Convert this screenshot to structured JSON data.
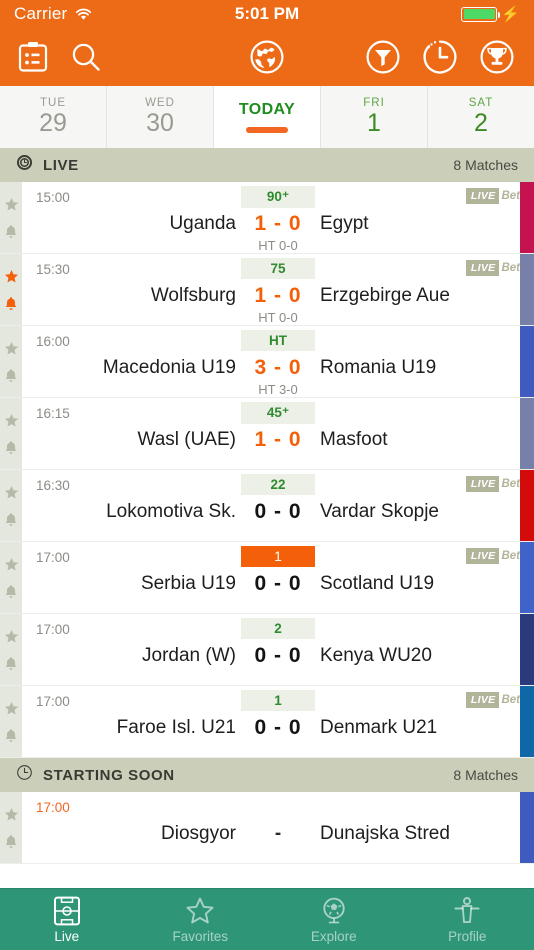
{
  "status_bar": {
    "carrier": "Carrier",
    "wifi_icon": "wifi-icon",
    "time": "5:01 PM",
    "battery_icon": "battery-icon",
    "charging_icon": "charging-bolt-icon"
  },
  "toolbar": {
    "scoreboard_icon": "scoreboard-icon",
    "search_icon": "search-icon",
    "globe_icon": "globe-icon",
    "filter_icon": "filter-icon",
    "clock_icon": "clock-icon",
    "trophy_icon": "trophy-icon",
    "background_color": "#ED6B16"
  },
  "date_tabs": [
    {
      "dow": "TUE",
      "day": "29",
      "state": "past"
    },
    {
      "dow": "WED",
      "day": "30",
      "state": "past"
    },
    {
      "label": "TODAY",
      "state": "active"
    },
    {
      "dow": "FRI",
      "day": "1",
      "state": "future"
    },
    {
      "dow": "SAT",
      "day": "2",
      "state": "future"
    }
  ],
  "sections": [
    {
      "icon": "live-clock-icon",
      "title": "LIVE",
      "count": "8 Matches",
      "matches": [
        {
          "time": "15:00",
          "minute": "90⁺",
          "home": "Uganda",
          "score": "1 - 0",
          "away": "Egypt",
          "halftime": "HT 0-0",
          "bet_live": "LIVE",
          "bet_label": "Bet",
          "favorite": false,
          "strip_color": "#C4134E"
        },
        {
          "time": "15:30",
          "minute": "75",
          "home": "Wolfsburg",
          "score": "1 - 0",
          "away": "Erzgebirge Aue",
          "halftime": "HT 0-0",
          "bet_live": "LIVE",
          "bet_label": "Bet",
          "favorite": true,
          "strip_color": "#7680A8"
        },
        {
          "time": "16:00",
          "minute": "HT",
          "home": "Macedonia U19",
          "score": "3 - 0",
          "away": "Romania U19",
          "halftime": "HT 3-0",
          "bet_live": "",
          "bet_label": "",
          "favorite": false,
          "strip_color": "#3F5BBF"
        },
        {
          "time": "16:15",
          "minute": "45⁺",
          "home": "Wasl (UAE)",
          "score": "1 - 0",
          "away": "Masfoot",
          "halftime": "",
          "bet_live": "",
          "bet_label": "",
          "favorite": false,
          "strip_color": "#7680A8"
        },
        {
          "time": "16:30",
          "minute": "22",
          "home": "Lokomotiva Sk.",
          "score": "0 - 0",
          "away": "Vardar Skopje",
          "halftime": "",
          "bet_live": "LIVE",
          "bet_label": "Bet",
          "favorite": false,
          "strip_color": "#D30B0B"
        },
        {
          "time": "17:00",
          "minute": "1",
          "home": "Serbia U19",
          "score": "0 - 0",
          "away": "Scotland U19",
          "halftime": "",
          "bet_live": "LIVE",
          "bet_label": "Bet",
          "favorite": false,
          "strip_color": "#3F63C8",
          "kickoff": true
        },
        {
          "time": "17:00",
          "minute": "2",
          "home": "Jordan (W)",
          "score": "0 - 0",
          "away": "Kenya WU20",
          "halftime": "",
          "bet_live": "",
          "bet_label": "",
          "favorite": false,
          "strip_color": "#2B3A7A"
        },
        {
          "time": "17:00",
          "minute": "1",
          "home": "Faroe Isl. U21",
          "score": "0 - 0",
          "away": "Denmark U21",
          "halftime": "",
          "bet_live": "LIVE",
          "bet_label": "Bet",
          "favorite": false,
          "strip_color": "#0E68A8"
        }
      ]
    },
    {
      "icon": "starting-soon-clock-icon",
      "title": "STARTING SOON",
      "count": "8 Matches",
      "matches": [
        {
          "time": "17:00",
          "minute": "",
          "home": "Diosgyor",
          "score": "-",
          "away": "Dunajska Stred",
          "halftime": "",
          "bet_live": "",
          "bet_label": "",
          "favorite": false,
          "strip_color": "#3F5BBF",
          "upcoming": true
        }
      ]
    }
  ],
  "tab_bar": [
    {
      "label": "Live",
      "icon": "pitch-icon",
      "active": true
    },
    {
      "label": "Favorites",
      "icon": "star-icon",
      "active": false
    },
    {
      "label": "Explore",
      "icon": "globe-ball-icon",
      "active": false
    },
    {
      "label": "Profile",
      "icon": "person-icon",
      "active": false
    }
  ],
  "colors": {
    "brand_orange": "#ED6B16",
    "accent_orange": "#F26522",
    "tab_green": "#2E9577",
    "section_header": "#CBCEB9",
    "live_green": "#2E8B2E"
  }
}
